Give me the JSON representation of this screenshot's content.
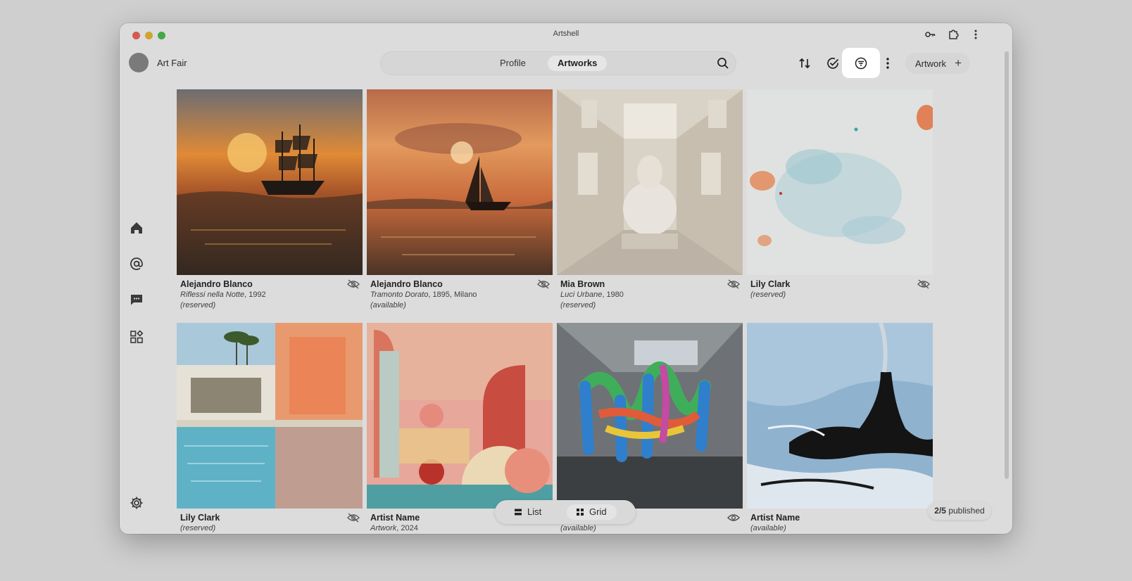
{
  "window": {
    "title": "Artshell"
  },
  "header": {
    "account_name": "Art Fair",
    "tabs": [
      {
        "label": "Profile"
      },
      {
        "label": "Artworks"
      }
    ],
    "active_tab": "Artworks",
    "add_button_label": "Artwork"
  },
  "view_toggle": {
    "list_label": "List",
    "grid_label": "Grid",
    "active": "Grid"
  },
  "published_badge": {
    "count": "2/5",
    "label": "published"
  },
  "artworks": [
    {
      "artist": "Alejandro Blanco",
      "title": "Riflessi nella Notte",
      "details": ", 1992",
      "status": "(reserved)",
      "visibility": "hidden"
    },
    {
      "artist": "Alejandro Blanco",
      "title": "Tramonto Dorato",
      "details": ", 1895, Milano",
      "status": "(available)",
      "visibility": "hidden"
    },
    {
      "artist": "Mia Brown",
      "title": "Luci Urbane",
      "details": ", 1980",
      "status": "(reserved)",
      "visibility": "hidden"
    },
    {
      "artist": "Lily Clark",
      "title": "",
      "details": "",
      "status": "(reserved)",
      "visibility": "hidden"
    },
    {
      "artist": "Lily Clark",
      "title": "",
      "details": "",
      "status": "(reserved)",
      "visibility": "hidden"
    },
    {
      "artist": "Artist Name",
      "title": "Artwork",
      "details": ", 2024",
      "status": "",
      "visibility": "hidden"
    },
    {
      "artist": "",
      "title": "",
      "details": "",
      "status": "(available)",
      "visibility": "visible"
    },
    {
      "artist": "Artist Name",
      "title": "",
      "details": "",
      "status": "(available)",
      "visibility": "visible"
    }
  ],
  "colors": {
    "overlay": "#dcdcdc",
    "highlight": "#ffffff",
    "avatar": "#7a7a7a"
  }
}
